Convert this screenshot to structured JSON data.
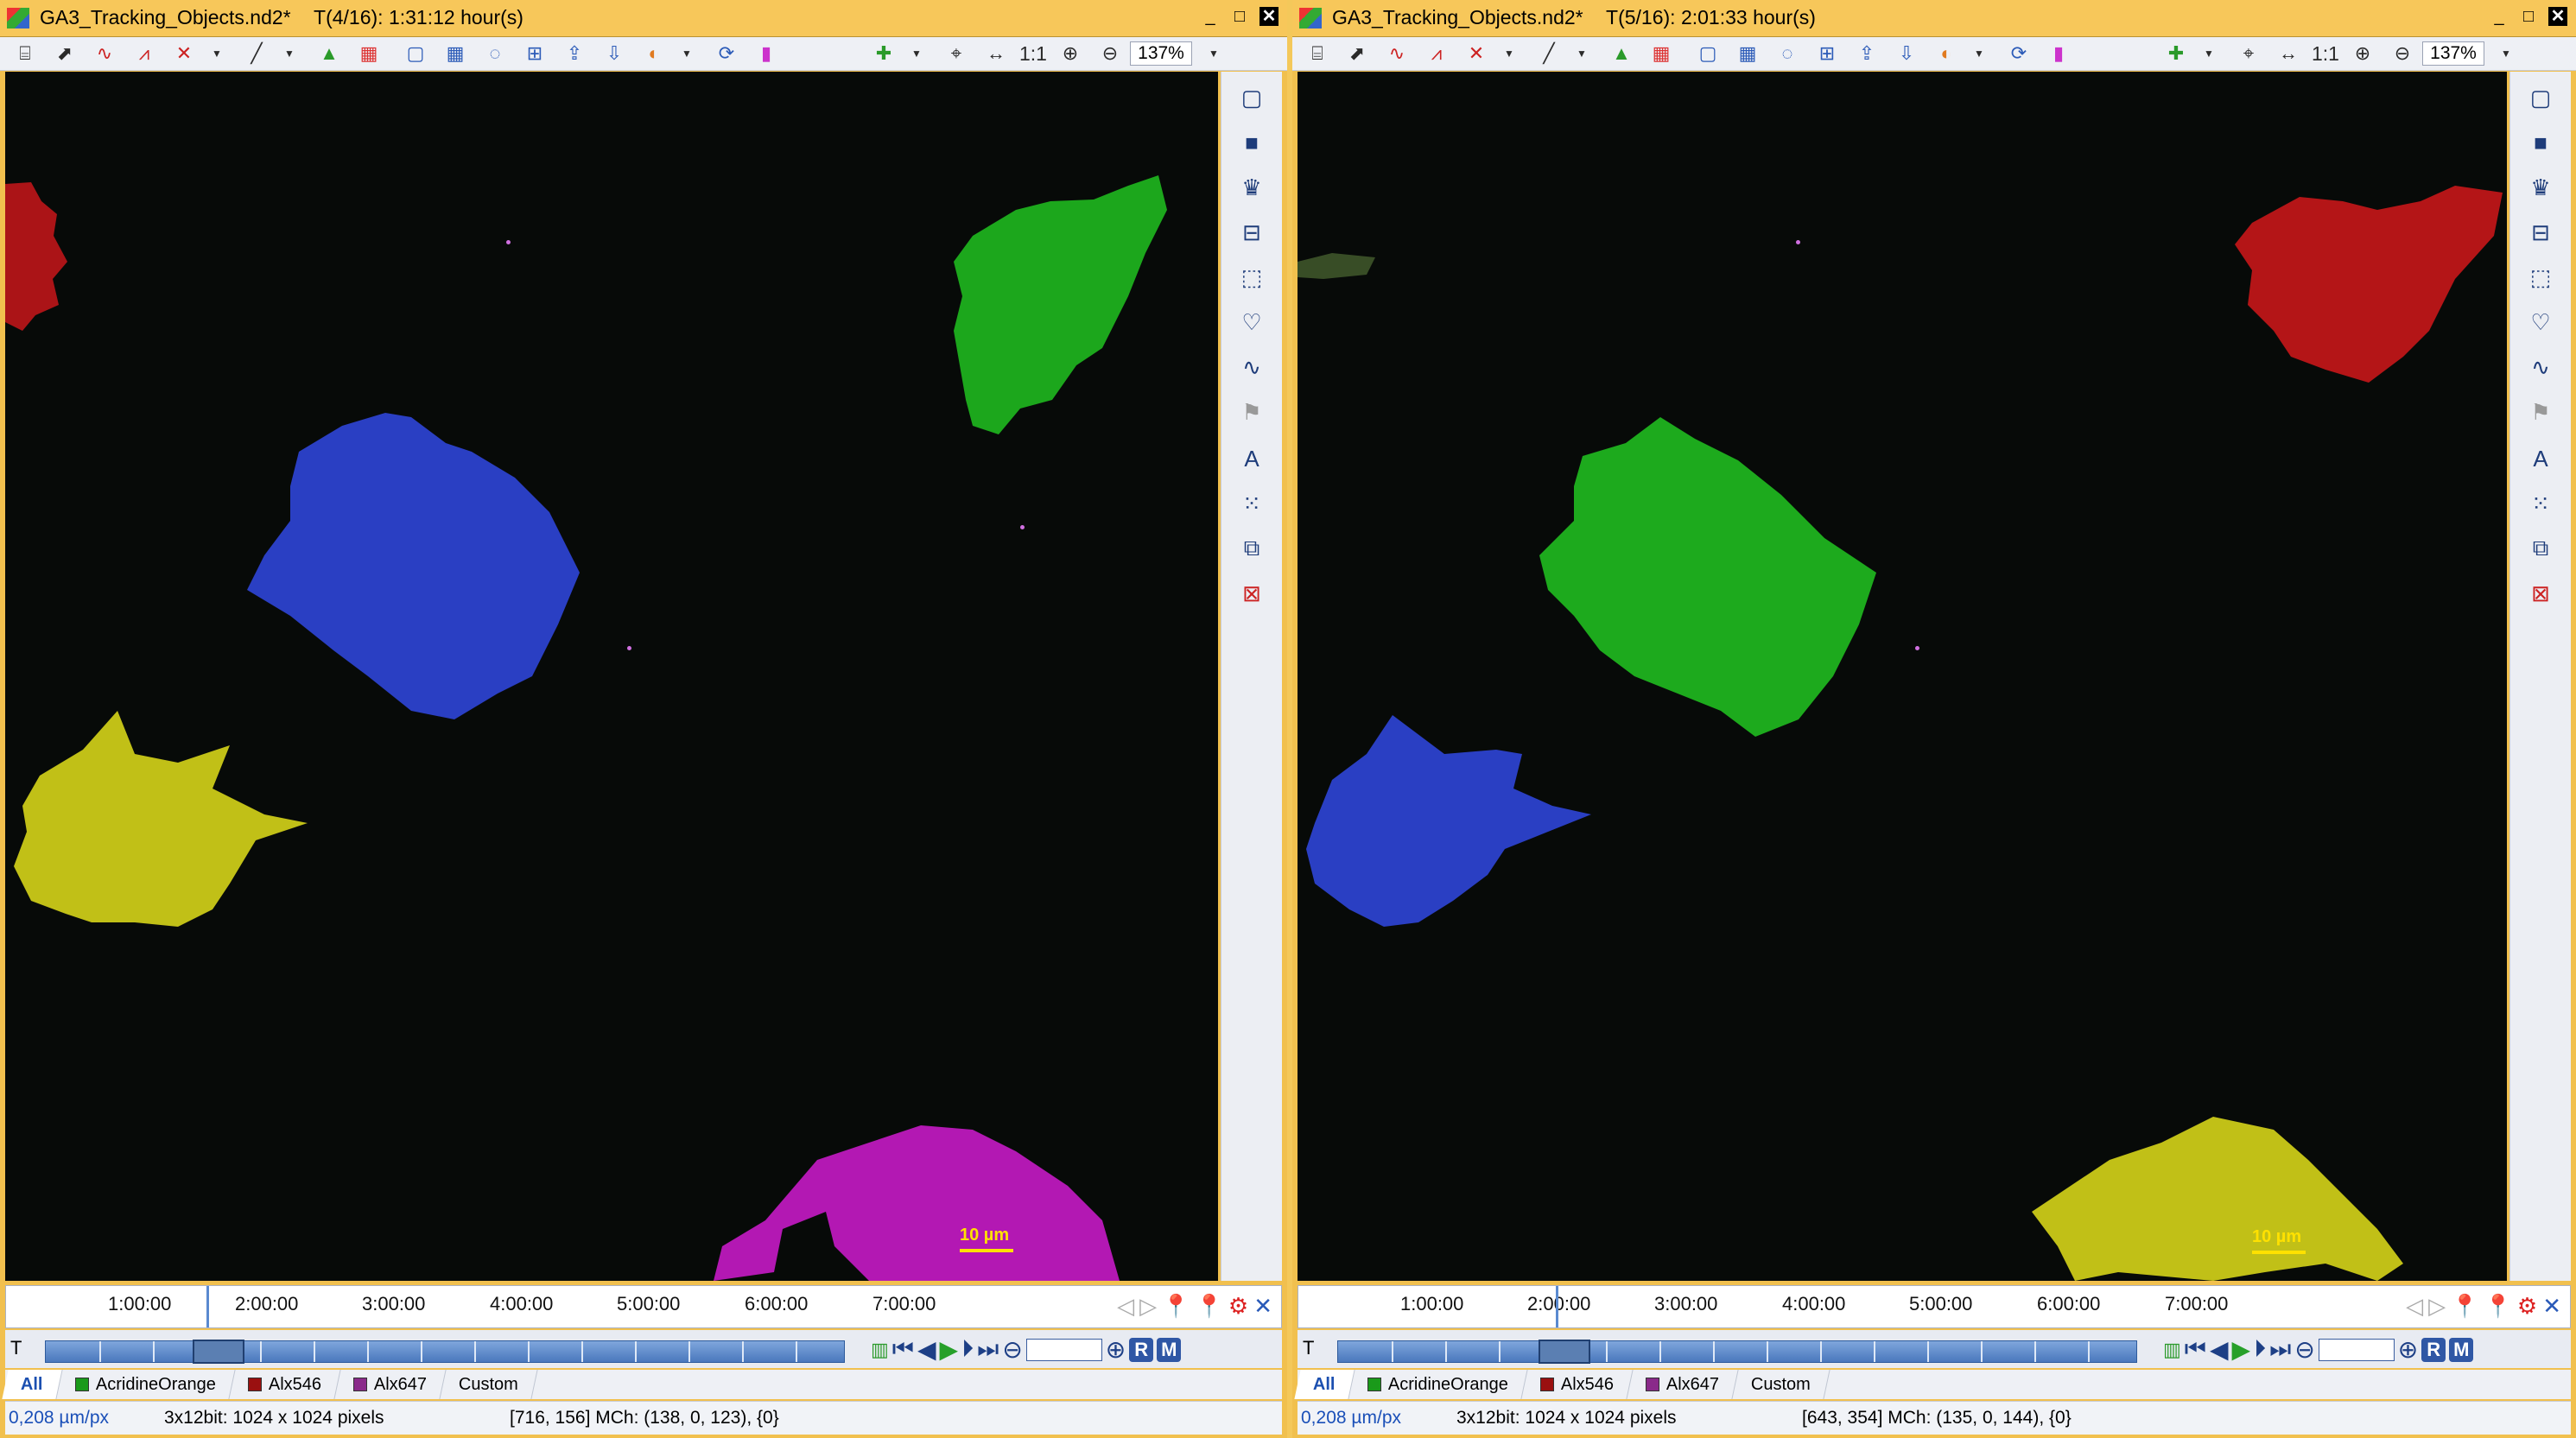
{
  "panes": [
    {
      "file": "GA3_Tracking_Objects.nd2*",
      "time_info": "T(4/16):  1:31:12 hour(s)",
      "zoom": "137%",
      "one_to_one": "1:1",
      "scale_label": "10 µm",
      "time_ticks": [
        "1:00:00",
        "2:00:00",
        "3:00:00",
        "4:00:00",
        "5:00:00",
        "6:00:00",
        "7:00:00"
      ],
      "t_label": "T",
      "tabs": [
        "All",
        "AcridineOrange",
        "Alx546",
        "Alx647",
        "Custom"
      ],
      "status": {
        "pixel_size": "0,208 µm/px",
        "format": "3x12bit: 1024 x 1024 pixels",
        "readout": "[716, 156] MCh: (138, 0, 123), {0}"
      },
      "current_frame": 4
    },
    {
      "file": "GA3_Tracking_Objects.nd2*",
      "time_info": "T(5/16):  2:01:33 hour(s)",
      "zoom": "137%",
      "one_to_one": "1:1",
      "scale_label": "10 µm",
      "time_ticks": [
        "1:00:00",
        "2:00:00",
        "3:00:00",
        "4:00:00",
        "5:00:00",
        "6:00:00",
        "7:00:00"
      ],
      "t_label": "T",
      "tabs": [
        "All",
        "AcridineOrange",
        "Alx546",
        "Alx647",
        "Custom"
      ],
      "status": {
        "pixel_size": "0,208 µm/px",
        "format": "3x12bit: 1024 x 1024 pixels",
        "readout": "[643, 354] MCh: (135, 0, 144), {0}"
      },
      "current_frame": 5
    }
  ],
  "buttons": {
    "r": "R",
    "m": "M"
  },
  "window_buttons": {
    "minimize": "_",
    "maximize": "□",
    "close": "✕"
  },
  "colors": {
    "title_bg": "#f7c75a",
    "tracking_blue": "#2f45d8",
    "tracking_green": "#1fb81f",
    "tracking_yellow": "#d6d41a",
    "tracking_red": "#c8161a",
    "tracking_magenta": "#c61ac6",
    "channel_acridine": "#1a9a1a",
    "channel_alx546": "#9a1010",
    "channel_alx647": "#8a2a8a"
  }
}
